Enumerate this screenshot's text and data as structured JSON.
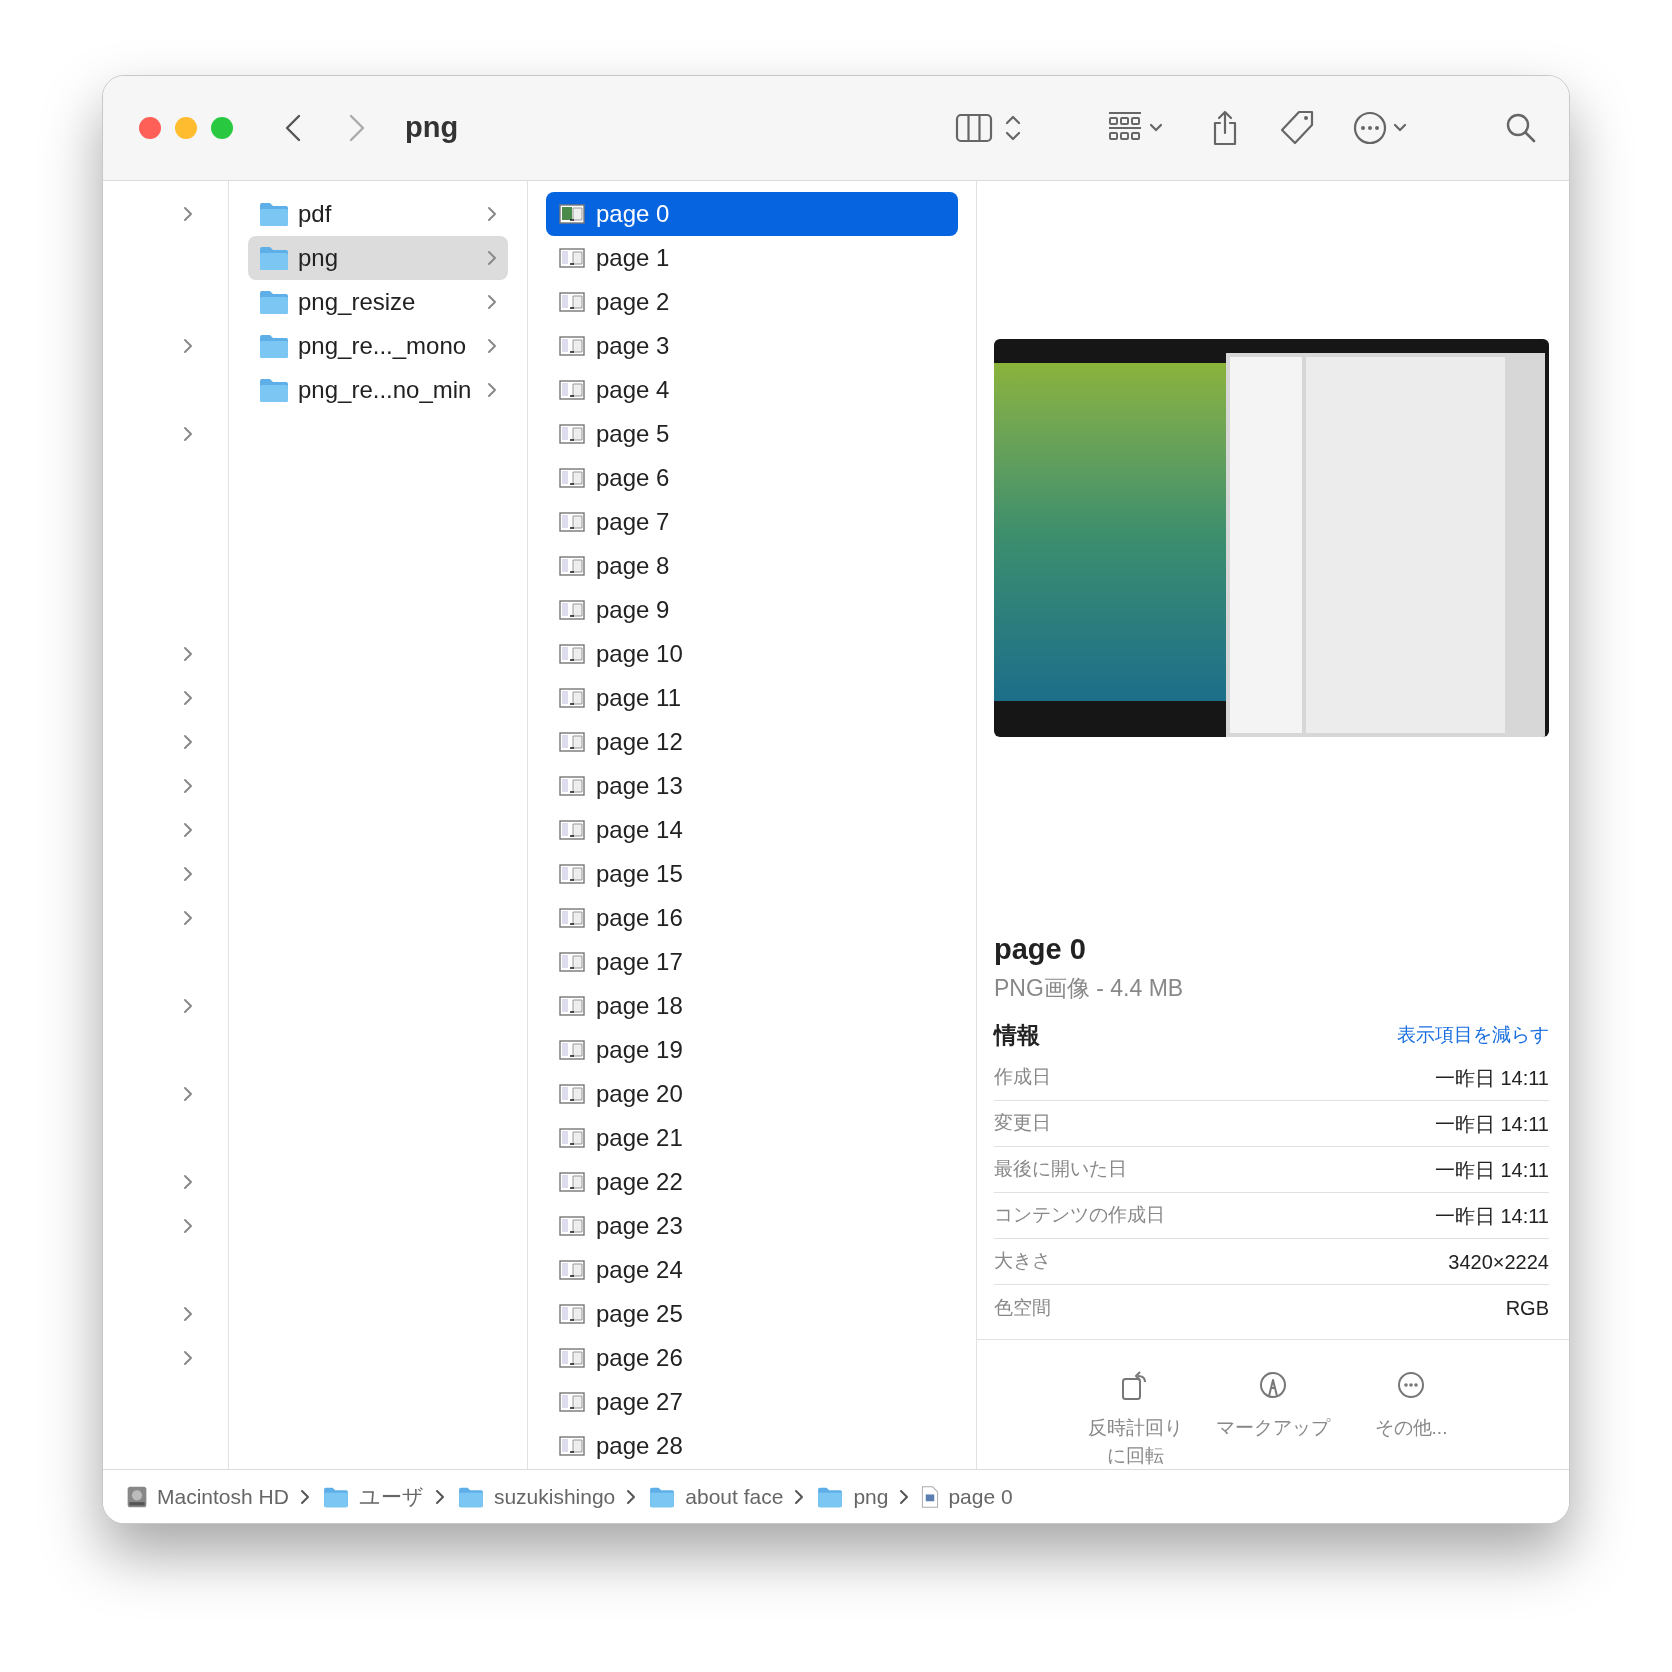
{
  "window": {
    "title": "png"
  },
  "column_1": {
    "rows": [
      {
        "has_children": true
      },
      {
        "has_children": false
      },
      {
        "has_children": false
      },
      {
        "has_children": true
      },
      {
        "has_children": false
      },
      {
        "has_children": true
      },
      {
        "has_children": false
      },
      {
        "has_children": false
      },
      {
        "has_children": false
      },
      {
        "has_children": false
      },
      {
        "has_children": true
      },
      {
        "has_children": true
      },
      {
        "has_children": true
      },
      {
        "has_children": true
      },
      {
        "has_children": true
      },
      {
        "has_children": true
      },
      {
        "has_children": true
      },
      {
        "has_children": false
      },
      {
        "has_children": true
      },
      {
        "has_children": false
      },
      {
        "has_children": true
      },
      {
        "has_children": false
      },
      {
        "has_children": true
      },
      {
        "has_children": true
      },
      {
        "has_children": false
      },
      {
        "has_children": true
      },
      {
        "has_children": true
      },
      {
        "has_children": false
      },
      {
        "has_children": false
      }
    ]
  },
  "column_2": {
    "items": [
      {
        "name": "pdf",
        "selected": false
      },
      {
        "name": "png",
        "selected": true
      },
      {
        "name": "png_resize",
        "selected": false
      },
      {
        "name": "png_re..._mono",
        "selected": false
      },
      {
        "name": "png_re...no_min",
        "selected": false
      }
    ]
  },
  "column_3": {
    "items": [
      {
        "name": "page 0",
        "selected": true
      },
      {
        "name": "page 1",
        "selected": false
      },
      {
        "name": "page 2",
        "selected": false
      },
      {
        "name": "page 3",
        "selected": false
      },
      {
        "name": "page 4",
        "selected": false
      },
      {
        "name": "page 5",
        "selected": false
      },
      {
        "name": "page 6",
        "selected": false
      },
      {
        "name": "page 7",
        "selected": false
      },
      {
        "name": "page 8",
        "selected": false
      },
      {
        "name": "page 9",
        "selected": false
      },
      {
        "name": "page 10",
        "selected": false
      },
      {
        "name": "page 11",
        "selected": false
      },
      {
        "name": "page 12",
        "selected": false
      },
      {
        "name": "page 13",
        "selected": false
      },
      {
        "name": "page 14",
        "selected": false
      },
      {
        "name": "page 15",
        "selected": false
      },
      {
        "name": "page 16",
        "selected": false
      },
      {
        "name": "page 17",
        "selected": false
      },
      {
        "name": "page 18",
        "selected": false
      },
      {
        "name": "page 19",
        "selected": false
      },
      {
        "name": "page 20",
        "selected": false
      },
      {
        "name": "page 21",
        "selected": false
      },
      {
        "name": "page 22",
        "selected": false
      },
      {
        "name": "page 23",
        "selected": false
      },
      {
        "name": "page 24",
        "selected": false
      },
      {
        "name": "page 25",
        "selected": false
      },
      {
        "name": "page 26",
        "selected": false
      },
      {
        "name": "page 27",
        "selected": false
      },
      {
        "name": "page 28",
        "selected": false
      }
    ]
  },
  "preview": {
    "name": "page 0",
    "kind_size": "PNG画像 - 4.4 MB",
    "info_heading": "情報",
    "toggle_link": "表示項目を減らす",
    "info_rows": [
      {
        "label": "作成日",
        "value": "一昨日 14:11"
      },
      {
        "label": "変更日",
        "value": "一昨日 14:11"
      },
      {
        "label": "最後に開いた日",
        "value": "一昨日 14:11"
      },
      {
        "label": "コンテンツの作成日",
        "value": "一昨日 14:11"
      },
      {
        "label": "大きさ",
        "value": "3420×2224"
      },
      {
        "label": "色空間",
        "value": "RGB"
      }
    ],
    "actions": [
      {
        "kind": "rotate",
        "label": "反時計回りに回転"
      },
      {
        "kind": "markup",
        "label": "マークアップ"
      },
      {
        "kind": "more",
        "label": "その他..."
      }
    ]
  },
  "path_bar": [
    {
      "kind": "disk",
      "label": "Macintosh HD"
    },
    {
      "kind": "user-folder",
      "label": "ユーザ"
    },
    {
      "kind": "home-folder",
      "label": "suzukishingo"
    },
    {
      "kind": "folder",
      "label": "about face"
    },
    {
      "kind": "folder",
      "label": "png"
    },
    {
      "kind": "file",
      "label": "page 0"
    }
  ]
}
